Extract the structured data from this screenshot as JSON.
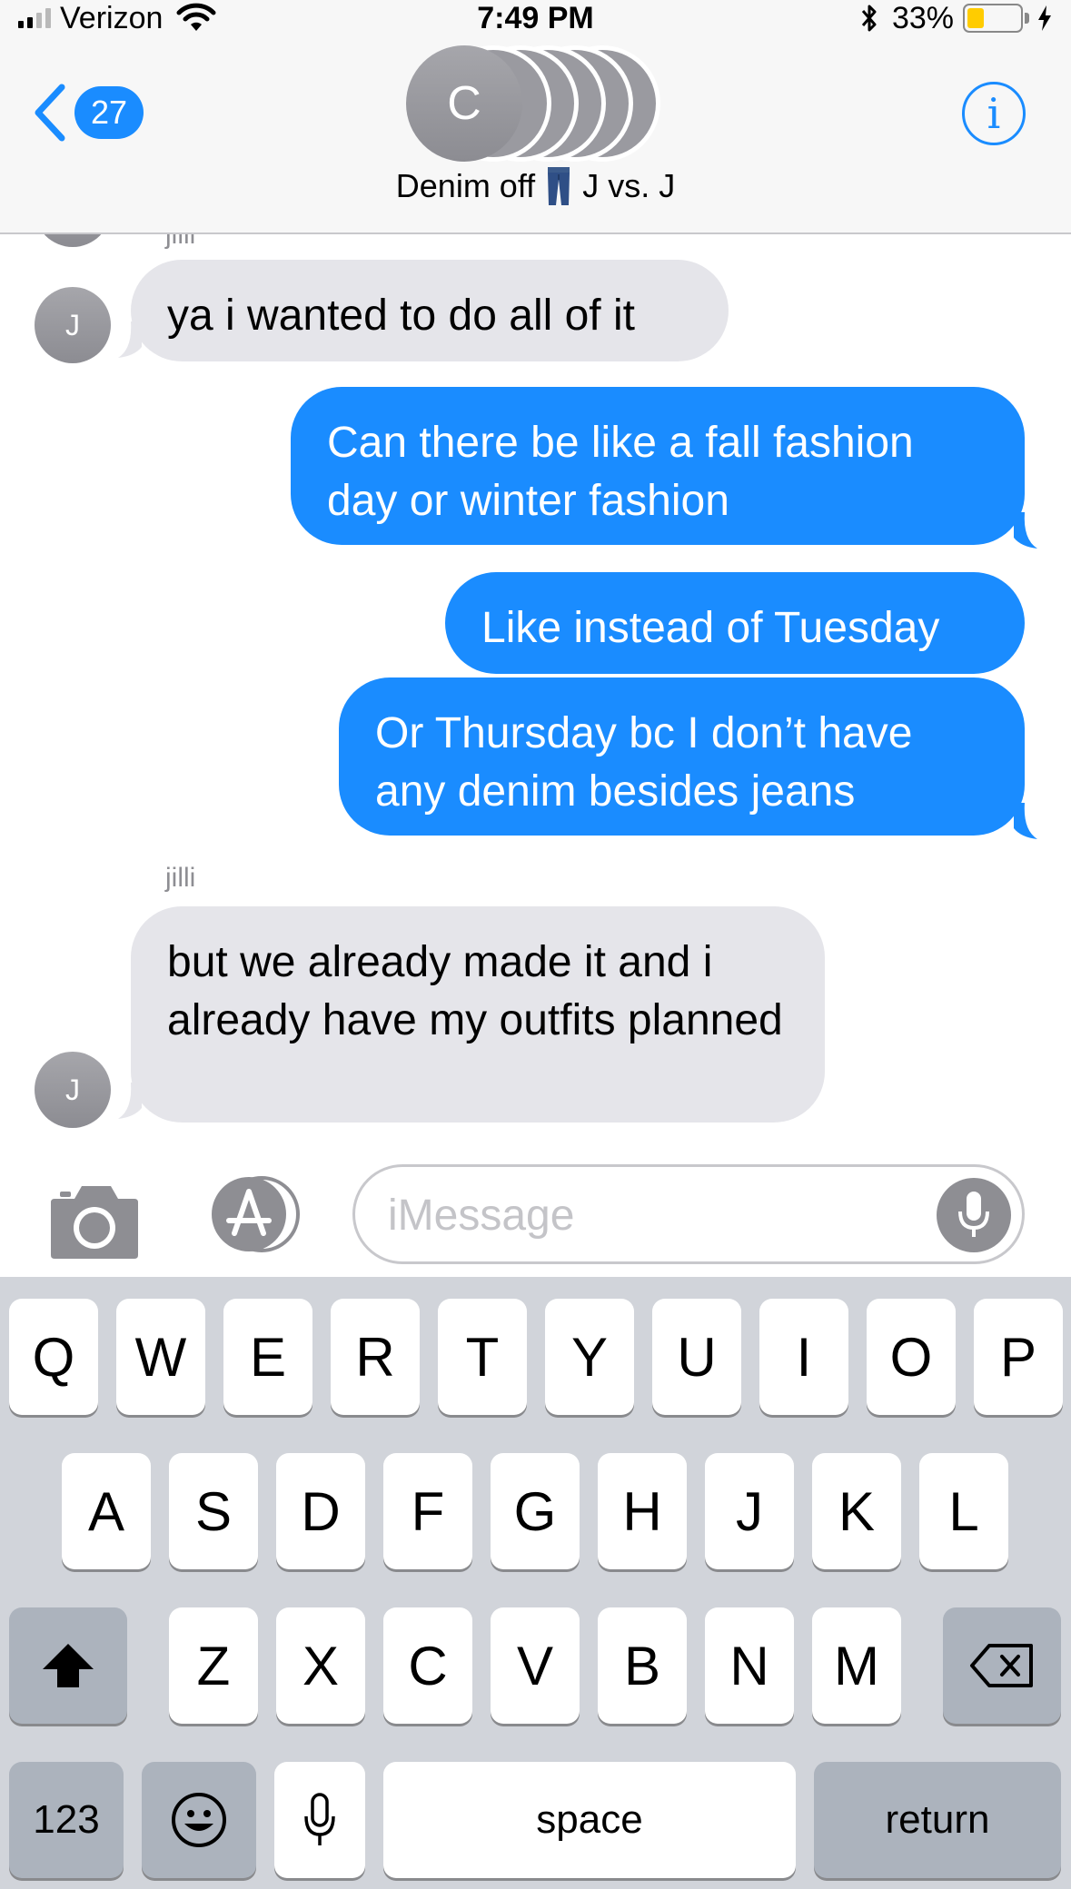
{
  "status_bar": {
    "carrier": "Verizon",
    "time": "7:49 PM",
    "battery_percent": "33%",
    "battery_level": 0.33,
    "signal_bars_filled": 2,
    "signal_bars_total": 4
  },
  "header": {
    "back_badge": "27",
    "group_avatar_initial": "C",
    "group_name": "Denim off",
    "group_name_suffix": "J vs. J",
    "info_label": "i"
  },
  "conversation": {
    "top_sender_partial": "jilli",
    "messages": [
      {
        "direction": "incoming",
        "sender_initial": "J",
        "text": "ya i wanted to do all of it"
      },
      {
        "direction": "outgoing",
        "text": "Can there be like a fall fashion day or winter fashion"
      },
      {
        "direction": "outgoing",
        "text": "Like instead of Tuesday"
      },
      {
        "direction": "outgoing",
        "text": "Or Thursday bc I don’t have any denim besides jeans"
      },
      {
        "direction": "incoming",
        "sender_name": "jilli",
        "sender_initial": "J",
        "text": "but we already made it and i already have my outfits planned"
      }
    ]
  },
  "input_bar": {
    "placeholder": "iMessage",
    "value": ""
  },
  "keyboard": {
    "row1": [
      "Q",
      "W",
      "E",
      "R",
      "T",
      "Y",
      "U",
      "I",
      "O",
      "P"
    ],
    "row2": [
      "A",
      "S",
      "D",
      "F",
      "G",
      "H",
      "J",
      "K",
      "L"
    ],
    "row3": [
      "Z",
      "X",
      "C",
      "V",
      "B",
      "N",
      "M"
    ],
    "numbers_key": "123",
    "space_key": "space",
    "return_key": "return"
  },
  "colors": {
    "accent": "#1a8cff",
    "incoming_bubble": "#e5e5ea",
    "keyboard_bg": "#d1d4da",
    "battery_fill": "#ffcc00"
  }
}
